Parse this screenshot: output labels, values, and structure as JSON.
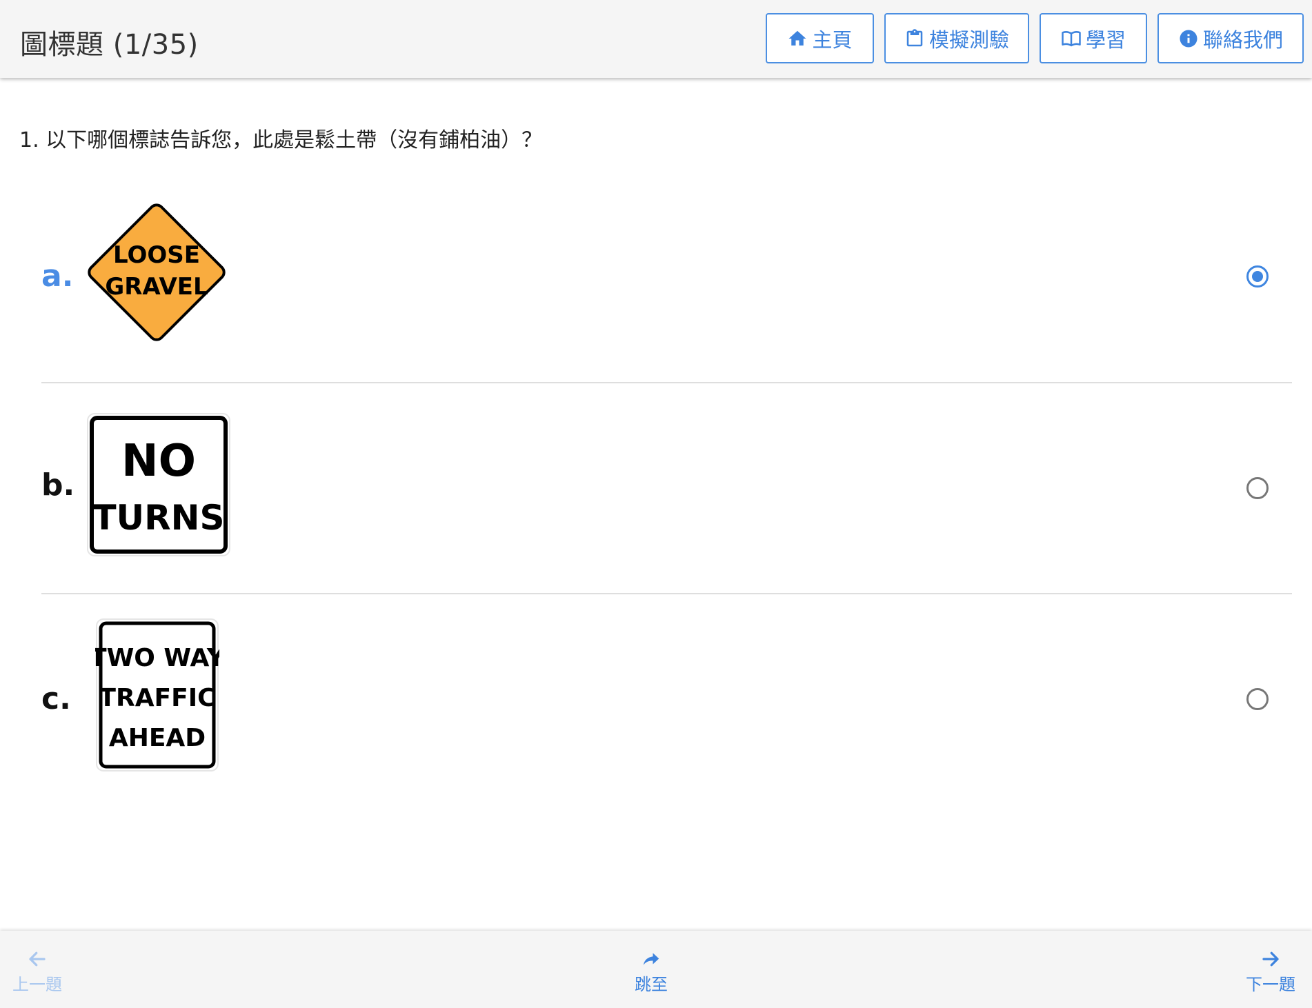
{
  "header": {
    "title": "圖標題 (1/35)",
    "nav": {
      "home_label": "主頁",
      "mock_test_label": "模擬測驗",
      "study_label": "學習",
      "contact_label": "聯絡我們"
    }
  },
  "question": {
    "text": "1. 以下哪個標誌告訴您，此處是鬆土帶（沒有鋪柏油）？"
  },
  "options": [
    {
      "letter": "a.",
      "selected": true,
      "sign_lines": [
        "LOOSE",
        "GRAVEL"
      ],
      "sign_color": "#f9ac3f"
    },
    {
      "letter": "b.",
      "selected": false,
      "sign_lines": [
        "NO",
        "TURNS"
      ],
      "sign_color": "#ffffff"
    },
    {
      "letter": "c.",
      "selected": false,
      "sign_lines": [
        "TWO WAY",
        "TRAFFIC",
        "AHEAD"
      ],
      "sign_color": "#ffffff"
    }
  ],
  "footer": {
    "prev_label": "上一題",
    "jump_label": "跳至",
    "next_label": "下一題"
  },
  "colors": {
    "accent": "#3d83de",
    "disabled": "#a9c7ef",
    "header_bg": "#f5f5f5"
  },
  "icons": {
    "home": "home-icon",
    "mock_test": "clipboard-icon",
    "study": "book-open-icon",
    "contact": "info-circle-icon",
    "prev": "arrow-left-icon",
    "jump": "share-arrow-icon",
    "next": "arrow-right-icon"
  }
}
